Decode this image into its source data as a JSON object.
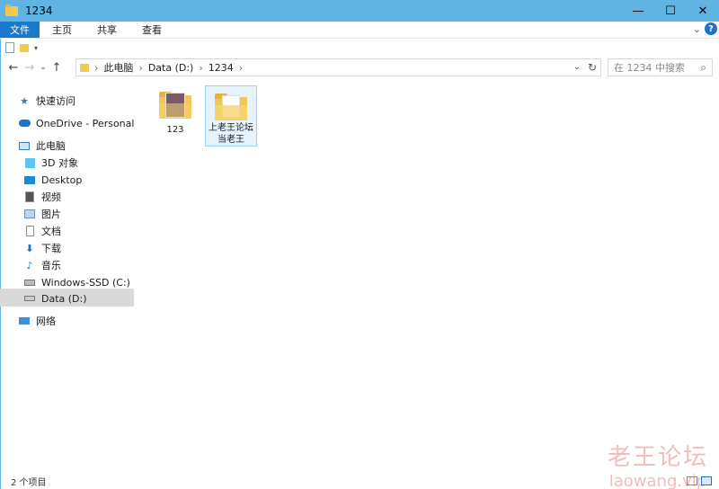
{
  "window": {
    "title": "1234",
    "controls": {
      "minimize": "—",
      "maximize": "☐",
      "close": "✕"
    }
  },
  "ribbon": {
    "tabs": [
      {
        "label": "文件"
      },
      {
        "label": "主页"
      },
      {
        "label": "共享"
      },
      {
        "label": "查看"
      }
    ],
    "help": "?"
  },
  "address": {
    "crumbs": [
      "此电脑",
      "Data (D:)",
      "1234"
    ]
  },
  "search": {
    "placeholder": "在 1234 中搜索"
  },
  "sidebar": {
    "items": [
      {
        "label": "快速访问",
        "icon": "star-icon"
      },
      {
        "label": "OneDrive - Personal",
        "icon": "cloud-icon"
      },
      {
        "label": "此电脑",
        "icon": "computer-icon"
      },
      {
        "label": "3D 对象",
        "icon": "cube-icon"
      },
      {
        "label": "Desktop",
        "icon": "desktop-icon"
      },
      {
        "label": "视频",
        "icon": "video-icon"
      },
      {
        "label": "图片",
        "icon": "picture-icon"
      },
      {
        "label": "文档",
        "icon": "document-icon"
      },
      {
        "label": "下载",
        "icon": "download-icon"
      },
      {
        "label": "音乐",
        "icon": "music-icon"
      },
      {
        "label": "Windows-SSD (C:)",
        "icon": "drive-c-icon"
      },
      {
        "label": "Data (D:)",
        "icon": "drive-d-icon"
      },
      {
        "label": "网络",
        "icon": "network-icon"
      }
    ]
  },
  "files": [
    {
      "name": "123",
      "type": "folder-with-photo"
    },
    {
      "name": "上老王论坛当老王",
      "type": "folder-with-documents"
    }
  ],
  "status": {
    "item_count": "2 个项目"
  },
  "watermark": {
    "line1": "老王论坛",
    "line2": "laowang.vip"
  },
  "colors": {
    "titlebar": "#5fb4e3",
    "file_tab": "#1979ca",
    "folder": "#f2c558"
  }
}
